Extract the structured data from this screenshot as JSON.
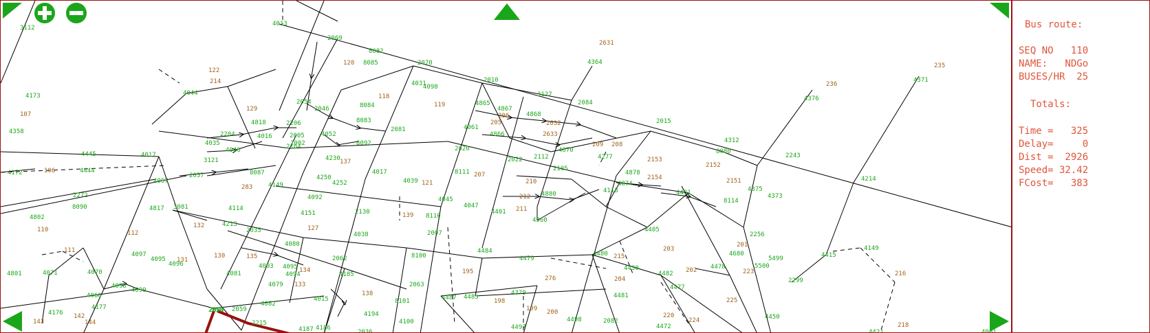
{
  "panel": {
    "title": "Bus route:",
    "seq_no": "SEQ NO   110",
    "name": "NAME:   NDGo",
    "buses": "BUSES/HR  25",
    "totals_title": "Totals:",
    "time": "Time =   325",
    "delay": "Delay=     0",
    "dist": "Dist =  2926",
    "speed": "Speed= 32.42",
    "fcost": "FCost=   383"
  },
  "controls": {
    "zoom_in": "zoom-in",
    "zoom_out": "zoom-out"
  },
  "colors": {
    "node_label": "#1aa61a",
    "stop_label": "#a0621a",
    "route": "#9a1010",
    "panel_text": "#e0553a",
    "control": "#1aa61a"
  },
  "nodes": [
    {
      "id": "3112"
    },
    {
      "id": "4013"
    },
    {
      "id": "2069"
    },
    {
      "id": "8082"
    },
    {
      "id": "8085"
    },
    {
      "id": "120"
    },
    {
      "id": "2631"
    },
    {
      "id": "4364"
    },
    {
      "id": "235"
    },
    {
      "id": "4371"
    },
    {
      "id": "236"
    },
    {
      "id": "4376"
    },
    {
      "id": "122"
    },
    {
      "id": "214"
    },
    {
      "id": "2010"
    },
    {
      "id": "2070"
    },
    {
      "id": "4031"
    },
    {
      "id": "4098"
    },
    {
      "id": "119"
    },
    {
      "id": "4044"
    },
    {
      "id": "4173"
    },
    {
      "id": "107"
    },
    {
      "id": "4358"
    },
    {
      "id": "129"
    },
    {
      "id": "4818"
    },
    {
      "id": "2054"
    },
    {
      "id": "2046"
    },
    {
      "id": "8084"
    },
    {
      "id": "118"
    },
    {
      "id": "8083"
    },
    {
      "id": "4865"
    },
    {
      "id": "4867"
    },
    {
      "id": "206"
    },
    {
      "id": "4868"
    },
    {
      "id": "3127"
    },
    {
      "id": "2084"
    },
    {
      "id": "2015"
    },
    {
      "id": "4061"
    },
    {
      "id": "205"
    },
    {
      "id": "2632"
    },
    {
      "id": "2633"
    },
    {
      "id": "4016"
    },
    {
      "id": "2005"
    },
    {
      "id": "2206"
    },
    {
      "id": "4035"
    },
    {
      "id": "2204"
    },
    {
      "id": "2002"
    },
    {
      "id": "4046"
    },
    {
      "id": "2081"
    },
    {
      "id": "8092"
    },
    {
      "id": "4052"
    },
    {
      "id": "4866"
    },
    {
      "id": "4870"
    },
    {
      "id": "208"
    },
    {
      "id": "209"
    },
    {
      "id": "4277"
    },
    {
      "id": "4312"
    },
    {
      "id": "8080"
    },
    {
      "id": "2243"
    },
    {
      "id": "2152"
    },
    {
      "id": "4017"
    },
    {
      "id": "3121"
    },
    {
      "id": "2164"
    },
    {
      "id": "4230"
    },
    {
      "id": "137"
    },
    {
      "id": "4017b"
    },
    {
      "id": "2020"
    },
    {
      "id": "2022"
    },
    {
      "id": "2112"
    },
    {
      "id": "2153"
    },
    {
      "id": "4172"
    },
    {
      "id": "106"
    },
    {
      "id": "4444"
    },
    {
      "id": "4445"
    },
    {
      "id": "4097"
    },
    {
      "id": "2057"
    },
    {
      "id": "8087"
    },
    {
      "id": "4252"
    },
    {
      "id": "4250"
    },
    {
      "id": "4149"
    },
    {
      "id": "4039"
    },
    {
      "id": "121"
    },
    {
      "id": "8111"
    },
    {
      "id": "207"
    },
    {
      "id": "2105"
    },
    {
      "id": "4878"
    },
    {
      "id": "4874"
    },
    {
      "id": "2154"
    },
    {
      "id": "2151"
    },
    {
      "id": "4375"
    },
    {
      "id": "4214"
    },
    {
      "id": "2272"
    },
    {
      "id": "8090"
    },
    {
      "id": "4817"
    },
    {
      "id": "4802"
    },
    {
      "id": "110"
    },
    {
      "id": "283"
    },
    {
      "id": "4114"
    },
    {
      "id": "4092"
    },
    {
      "id": "2130"
    },
    {
      "id": "4045"
    },
    {
      "id": "4047"
    },
    {
      "id": "4401"
    },
    {
      "id": "212"
    },
    {
      "id": "211"
    },
    {
      "id": "210"
    },
    {
      "id": "4880"
    },
    {
      "id": "4360"
    },
    {
      "id": "4113"
    },
    {
      "id": "4431"
    },
    {
      "id": "8114"
    },
    {
      "id": "4373"
    },
    {
      "id": "139"
    },
    {
      "id": "8110"
    },
    {
      "id": "3081"
    },
    {
      "id": "132"
    },
    {
      "id": "4213"
    },
    {
      "id": "2035"
    },
    {
      "id": "4151"
    },
    {
      "id": "127"
    },
    {
      "id": "4038"
    },
    {
      "id": "2007"
    },
    {
      "id": "4405"
    },
    {
      "id": "203"
    },
    {
      "id": "201"
    },
    {
      "id": "4680"
    },
    {
      "id": "2256"
    },
    {
      "id": "112"
    },
    {
      "id": "111"
    },
    {
      "id": "4097b"
    },
    {
      "id": "4095"
    },
    {
      "id": "4096"
    },
    {
      "id": "131"
    },
    {
      "id": "130"
    },
    {
      "id": "135"
    },
    {
      "id": "4080"
    },
    {
      "id": "4081"
    },
    {
      "id": "4093"
    },
    {
      "id": "4094"
    },
    {
      "id": "134"
    },
    {
      "id": "2062"
    },
    {
      "id": "8100"
    },
    {
      "id": "4484"
    },
    {
      "id": "4479"
    },
    {
      "id": "4480"
    },
    {
      "id": "215"
    },
    {
      "id": "4430"
    },
    {
      "id": "4482"
    },
    {
      "id": "202"
    },
    {
      "id": "4478"
    },
    {
      "id": "223"
    },
    {
      "id": "5500"
    },
    {
      "id": "5499"
    },
    {
      "id": "4415"
    },
    {
      "id": "4149b"
    },
    {
      "id": "216"
    },
    {
      "id": "4801"
    },
    {
      "id": "4071"
    },
    {
      "id": "4070"
    },
    {
      "id": "4098b"
    },
    {
      "id": "4099"
    },
    {
      "id": "4095b"
    },
    {
      "id": "4079"
    },
    {
      "id": "133"
    },
    {
      "id": "4185"
    },
    {
      "id": "2063"
    },
    {
      "id": "195"
    },
    {
      "id": "2299"
    },
    {
      "id": "276"
    },
    {
      "id": "204"
    },
    {
      "id": "4477"
    },
    {
      "id": "4481"
    },
    {
      "id": "225"
    },
    {
      "id": "4450"
    },
    {
      "id": "4060"
    },
    {
      "id": "4177"
    },
    {
      "id": "4176"
    },
    {
      "id": "4082"
    },
    {
      "id": "4015"
    },
    {
      "id": "138"
    },
    {
      "id": "8101"
    },
    {
      "id": "4487"
    },
    {
      "id": "4485"
    },
    {
      "id": "198"
    },
    {
      "id": "4379"
    },
    {
      "id": "199"
    },
    {
      "id": "200"
    },
    {
      "id": "4498"
    },
    {
      "id": "2082"
    },
    {
      "id": "4497"
    },
    {
      "id": "220"
    },
    {
      "id": "224"
    },
    {
      "id": "4472"
    },
    {
      "id": "2058"
    },
    {
      "id": "143"
    },
    {
      "id": "142"
    },
    {
      "id": "144"
    },
    {
      "id": "2004"
    },
    {
      "id": "2059"
    },
    {
      "id": "2215"
    },
    {
      "id": "4187"
    },
    {
      "id": "4186"
    },
    {
      "id": "4100"
    },
    {
      "id": "4194"
    },
    {
      "id": "2036"
    },
    {
      "id": "4421"
    },
    {
      "id": "218"
    },
    {
      "id": "4001"
    }
  ]
}
